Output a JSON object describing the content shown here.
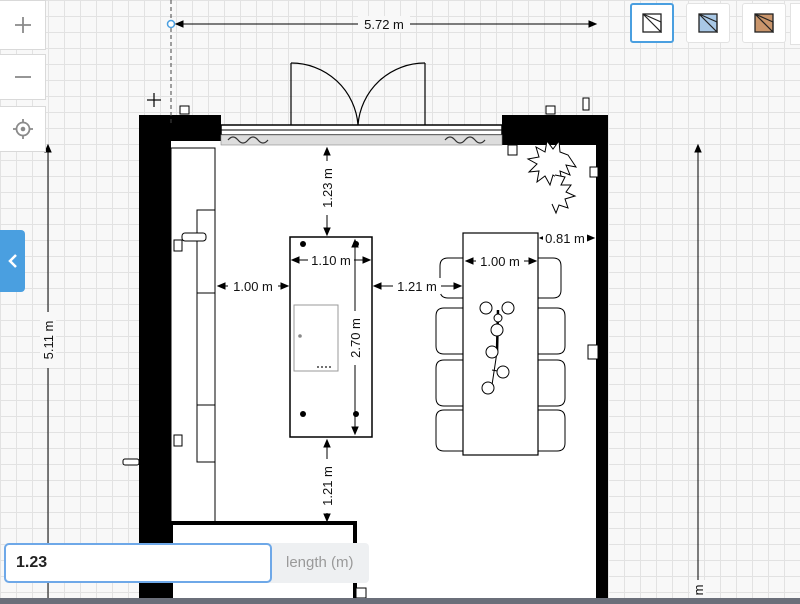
{
  "toolbar": {
    "zoom_in_icon": "plus-icon",
    "zoom_out_icon": "minus-icon",
    "center_icon": "crosshair-icon",
    "collapse_icon": "chevron-left-icon"
  },
  "swatches": [
    {
      "name": "outline",
      "fill": "#ffffff",
      "active": true
    },
    {
      "name": "blue",
      "fill": "#a9c8e6",
      "active": false
    },
    {
      "name": "wood",
      "fill": "#c9956b",
      "active": false
    }
  ],
  "dimensions": {
    "top_width": "5.72 m",
    "left_height": "5.11 m",
    "right_height": "m",
    "island_to_top": "1.23 m",
    "island_width": "1.10 m",
    "island_length": "2.70 m",
    "left_gap": "1.00 m",
    "island_to_table": "1.21 m",
    "island_to_bottom": "1.21 m",
    "table_width": "1.00 m",
    "table_to_wall": "0.81 m"
  },
  "length_input": {
    "value": "1.23",
    "unit_label": "length (m)"
  },
  "colors": {
    "accent": "#4a9fe0",
    "wall": "#000000",
    "grid": "#e2e2e2"
  }
}
